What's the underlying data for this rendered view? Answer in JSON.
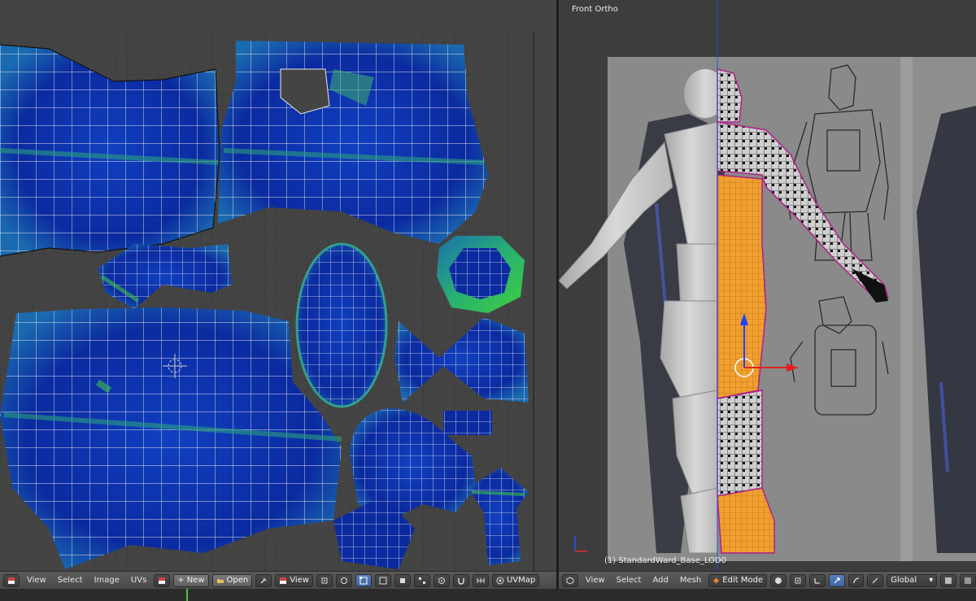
{
  "uv_editor": {
    "header": {
      "menus": [
        "View",
        "Select",
        "Image",
        "UVs"
      ],
      "new_label": "New",
      "open_label": "Open",
      "view_dropdown": "View",
      "uvmap_label": "UVMap"
    }
  },
  "viewport": {
    "view_name": "Front Ortho",
    "object_label": "(1) StandardWard_Base_LOD0",
    "header": {
      "menus": [
        "View",
        "Select",
        "Add",
        "Mesh"
      ],
      "mode_label": "Edit Mode",
      "orientation_label": "Global"
    }
  },
  "colors": {
    "uv_island_fill": "#0a2a9e",
    "uv_stretch_high": "#3fd04a",
    "selection_orange": "#f0a030",
    "seam_magenta": "#c0207a",
    "timeline_cursor": "#55c04a"
  }
}
